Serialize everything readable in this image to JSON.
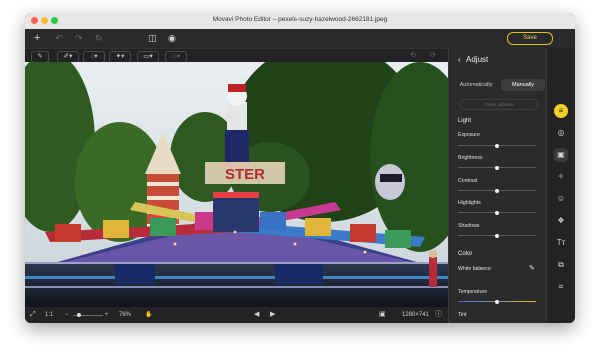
{
  "window": {
    "title": "Movavi Photo Editor – pexels-suzy-hazelwood-2662181.jpeg"
  },
  "toolbar": {
    "save_label": "Save"
  },
  "status": {
    "ratio": "1:1",
    "zoom": "76%",
    "dimensions": "1280×741"
  },
  "panel": {
    "title": "Adjust",
    "tabs": [
      "Automatically",
      "Manually"
    ],
    "reset_label": "Reset defaults",
    "light_section": "Light",
    "sliders": [
      {
        "label": "Exposure",
        "value": 0.5
      },
      {
        "label": "Brightness",
        "value": 0.5
      },
      {
        "label": "Contrast",
        "value": 0.5
      },
      {
        "label": "Highlights",
        "value": 0.5
      },
      {
        "label": "Shadows",
        "value": 0.5
      }
    ],
    "color_section": "Color",
    "white_balance_label": "White balance",
    "temperature": {
      "label": "Temperature",
      "value": 0.5
    },
    "tint_label": "Tint"
  },
  "colors": {
    "accent": "#f3d128",
    "background": "#1e1e20",
    "panel": "#2b2b2d"
  },
  "rail_icons": [
    "adjust-icon",
    "filters-icon",
    "crop-frame-icon",
    "retouch-icon",
    "face-icon",
    "effects-icon",
    "text-icon",
    "layers-icon",
    "crop-icon"
  ]
}
